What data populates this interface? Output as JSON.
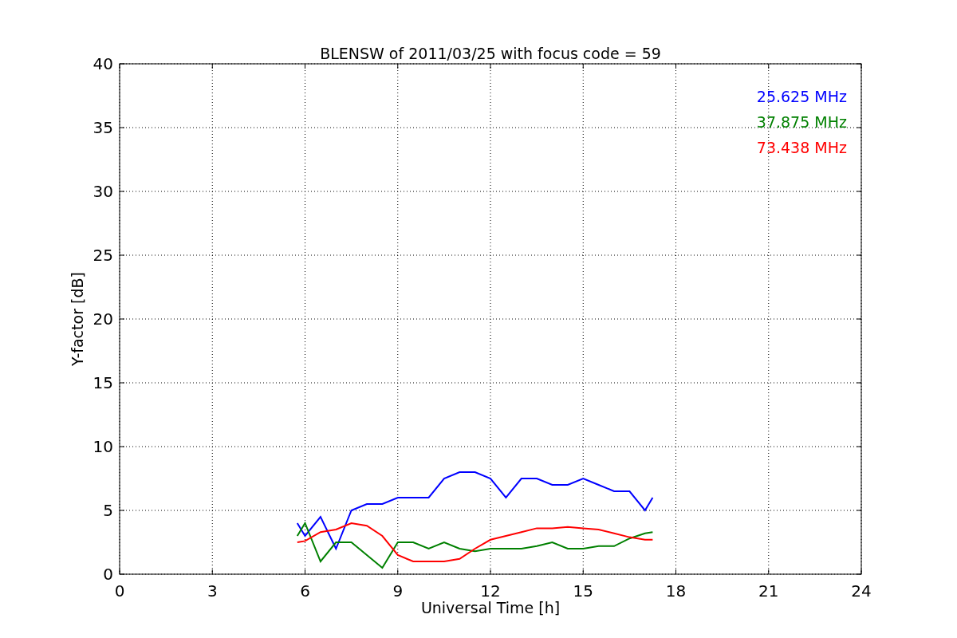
{
  "chart_data": {
    "type": "line",
    "title": "BLENSW of 2011/03/25 with focus code = 59",
    "xlabel": "Universal Time [h]",
    "ylabel": "Y-factor [dB]",
    "x": [
      5.75,
      6,
      6.5,
      7,
      7.5,
      8,
      8.5,
      9,
      9.5,
      10,
      10.5,
      11,
      11.5,
      12,
      12.5,
      13,
      13.5,
      14,
      14.5,
      15,
      15.5,
      16,
      16.5,
      17,
      17.25
    ],
    "series": [
      {
        "name": "25.625 MHz",
        "color": "#0000ff",
        "values": [
          4,
          3,
          4.5,
          2,
          5,
          5.5,
          5.5,
          6,
          6,
          6,
          7.5,
          8,
          8,
          7.5,
          6,
          7.5,
          7.5,
          7,
          7,
          7.5,
          7,
          6.5,
          6.5,
          5,
          6
        ]
      },
      {
        "name": "37.875 MHz",
        "color": "#008000",
        "values": [
          3,
          4,
          1,
          2.5,
          2.5,
          1.5,
          0.5,
          2.5,
          2.5,
          2,
          2.5,
          2,
          1.8,
          2,
          2,
          2,
          2.2,
          2.5,
          2,
          2,
          2.2,
          2.2,
          2.8,
          3.2,
          3.3
        ]
      },
      {
        "name": "73.438 MHz",
        "color": "#ff0000",
        "values": [
          2.5,
          2.6,
          3.3,
          3.5,
          4,
          3.8,
          3,
          1.5,
          1,
          1,
          1,
          1.2,
          2,
          2.7,
          3,
          3.3,
          3.6,
          3.6,
          3.7,
          3.6,
          3.5,
          3.2,
          2.9,
          2.7,
          2.7
        ]
      }
    ],
    "xlim": [
      0,
      24
    ],
    "ylim": [
      0,
      40
    ],
    "xticks": [
      0,
      3,
      6,
      9,
      12,
      15,
      18,
      21,
      24
    ],
    "yticks": [
      0,
      5,
      10,
      15,
      20,
      25,
      30,
      35,
      40
    ],
    "grid": true
  }
}
